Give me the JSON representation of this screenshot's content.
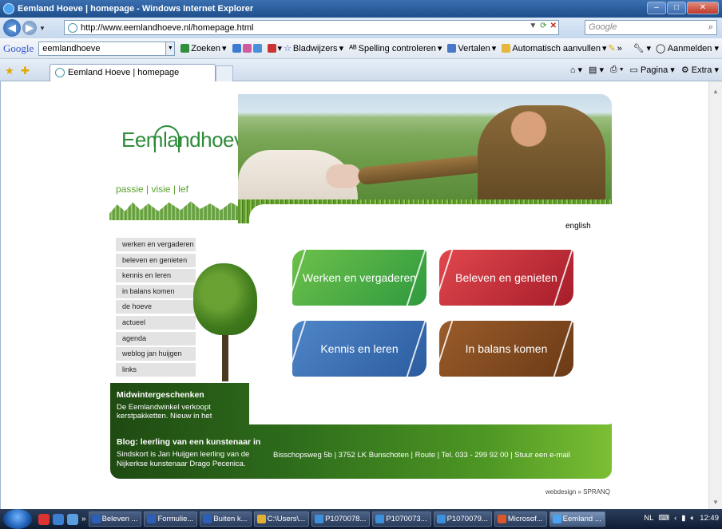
{
  "window": {
    "title": "Eemland Hoeve | homepage - Windows Internet Explorer"
  },
  "address": {
    "url": "http://www.eemlandhoeve.nl/homepage.html",
    "search_placeholder": "Google"
  },
  "googlebar": {
    "logo": "Google",
    "query": "eemlandhoeve",
    "items": [
      "Zoeken",
      "Bladwijzers",
      "Spelling controleren",
      "Vertalen",
      "Automatisch aanvullen"
    ],
    "signin": "Aanmelden"
  },
  "tabs": {
    "active_title": "Eemland Hoeve | homepage",
    "commands": [
      "Pagina",
      "Extra"
    ]
  },
  "site": {
    "logo_text": "Eemlandhoeve",
    "tagline": "passie | visie | lef",
    "language_link": "english",
    "menu": [
      "werken en vergaderen",
      "beleven en genieten",
      "kennis en leren",
      "in balans komen",
      "de hoeve",
      "actueel",
      "agenda",
      "weblog jan huijgen",
      "links"
    ],
    "tiles": {
      "green": "Werken en vergaderen",
      "red": "Beleven en genieten",
      "blue": "Kennis en leren",
      "brown": "In balans komen"
    },
    "news": {
      "title": "Midwintergeschenken",
      "body": "De Eemlandwinkel verkoopt kerstpakketten. Nieuw in het"
    },
    "blog": {
      "title": "Blog: leerling van een kunstenaar in",
      "body": "Sindskort is Jan Huijgen leerling van de Nijkerkse kunstenaar Drago Pecenica."
    },
    "address_line": "Bisschopsweg 5b  |  3752 LK Bunschoten  |  Route  |  Tel. 033 - 299 92 00  |  Stuur een e-mail",
    "credit": "webdesign » SPRANQ"
  },
  "taskbar": {
    "tasks": [
      "Beleven ...",
      "Formulie...",
      "Buiten k...",
      "C:\\Users\\...",
      "P1070078...",
      "P1070073...",
      "P1070079...",
      "Microsof...",
      "Eemland ..."
    ],
    "active_index": 8,
    "tray_lang": "NL",
    "clock": "12:49"
  },
  "colors": {
    "brand_green": "#2d8c3a",
    "tile_green": "#4fb044",
    "tile_red": "#c9303a",
    "tile_blue": "#3d72b6",
    "tile_brown": "#84481f"
  }
}
